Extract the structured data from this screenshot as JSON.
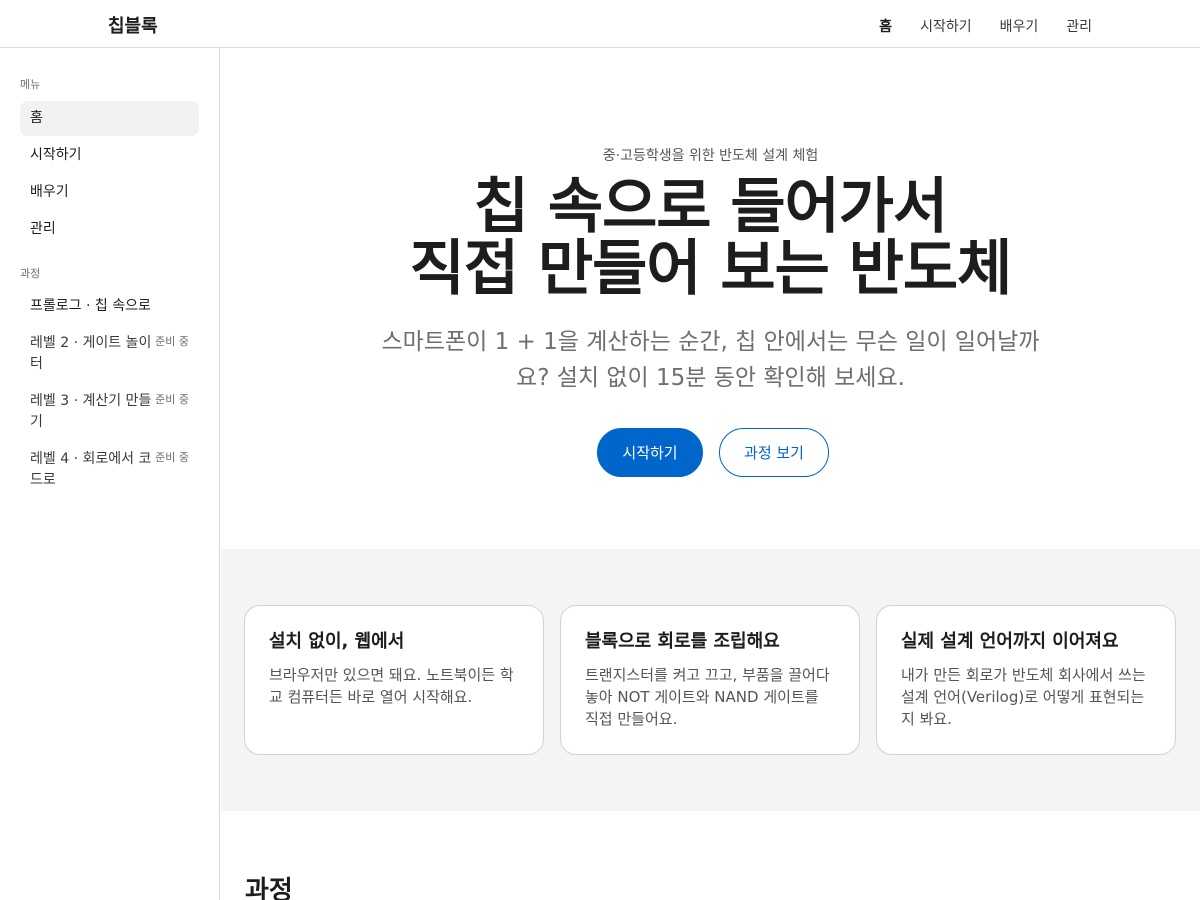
{
  "header": {
    "brand": "칩블록",
    "nav": [
      "홈",
      "시작하기",
      "배우기",
      "관리"
    ]
  },
  "sidebar": {
    "menu_heading": "메뉴",
    "menu_items": [
      "홈",
      "시작하기",
      "배우기",
      "관리"
    ],
    "course_heading": "과정",
    "courses": [
      {
        "label": "프롤로그 · 칩 속으로",
        "badge": ""
      },
      {
        "label": "레벨 2 · 게이트 놀이터",
        "badge": "준비 중"
      },
      {
        "label": "레벨 3 · 계산기 만들기",
        "badge": "준비 중"
      },
      {
        "label": "레벨 4 · 회로에서 코드로",
        "badge": "준비 중"
      }
    ]
  },
  "hero": {
    "eyebrow": "중·고등학생을 위한 반도체 설계 체험",
    "title_line1": "칩 속으로 들어가서",
    "title_line2": "직접 만들어 보는 반도체",
    "subtitle": "스마트폰이 1 + 1을 계산하는 순간, 칩 안에서는 무슨 일이 일어날까요? 설치 없이 15분 동안 확인해 보세요.",
    "primary_button": "시작하기",
    "secondary_button": "과정 보기"
  },
  "features": [
    {
      "title": "설치 없이, 웹에서",
      "body": "브라우저만 있으면 돼요. 노트북이든 학교 컴퓨터든 바로 열어 시작해요."
    },
    {
      "title": "블록으로 회로를 조립해요",
      "body": "트랜지스터를 켜고 끄고, 부품을 끌어다 놓아 NOT 게이트와 NAND 게이트를 직접 만들어요."
    },
    {
      "title": "실제 설계 언어까지 이어져요",
      "body": "내가 만든 회로가 반도체 회사에서 쓰는 설계 언어(Verilog)로 어떻게 표현되는지 봐요."
    }
  ],
  "courses_section": {
    "title": "과정"
  },
  "colors": {
    "accent": "#0066cc",
    "feature_bg": "#f4f4f7",
    "active_item_bg": "#f2f2f5"
  }
}
